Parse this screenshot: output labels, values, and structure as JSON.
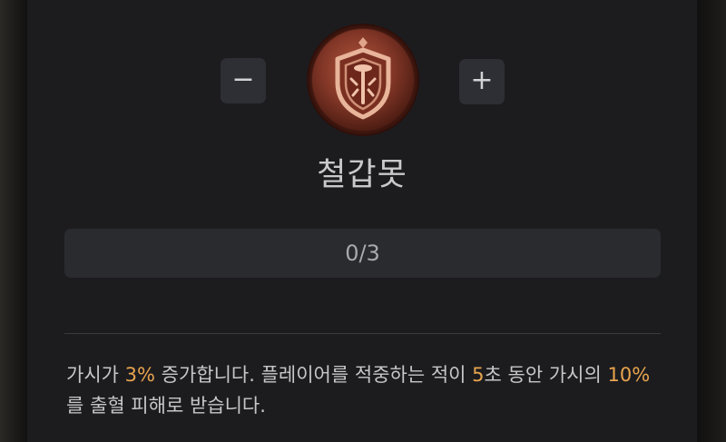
{
  "controls": {
    "decrease_label": "−",
    "increase_label": "+"
  },
  "skill": {
    "icon": "shield-emblem-icon",
    "name": "철갑못",
    "rank": "0/3"
  },
  "description": {
    "part1": "가시가 ",
    "value1": "3%",
    "part2": " 증가합니다. 플레이어를 적중하는 적이 ",
    "value2": "5",
    "part3": "초 동안 가시의 ",
    "value3": "10%",
    "part4": "를 출혈 피해로 받습니다."
  },
  "colors": {
    "highlight": "#e8a44e",
    "panel": "#1c1c1f",
    "button": "#2e2f34",
    "text": "#c7c7ca"
  }
}
